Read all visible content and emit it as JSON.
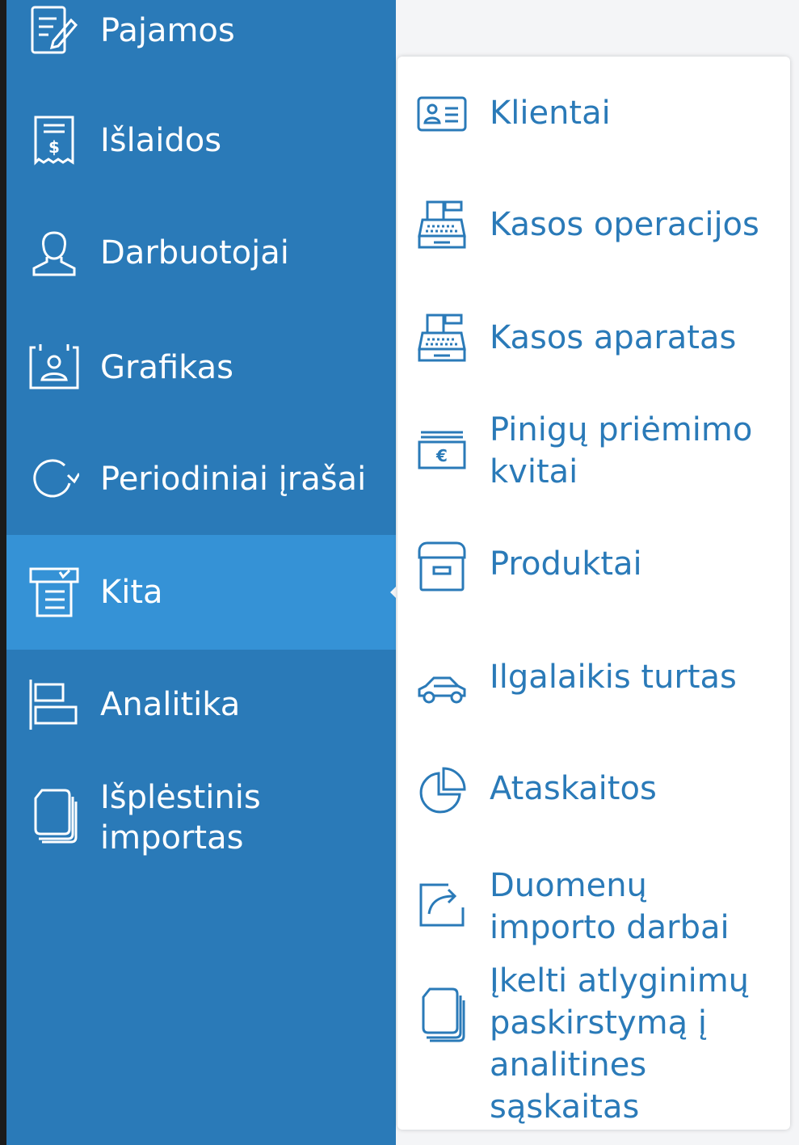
{
  "sidebar": {
    "items": [
      {
        "label": "Pajamos",
        "icon": "edit-document-icon"
      },
      {
        "label": "Išlaidos",
        "icon": "receipt-dollar-icon"
      },
      {
        "label": "Darbuotojai",
        "icon": "person-icon"
      },
      {
        "label": "Grafikas",
        "icon": "calendar-person-icon"
      },
      {
        "label": "Periodiniai įrašai",
        "icon": "refresh-icon"
      },
      {
        "label": "Kita",
        "icon": "list-box-icon"
      },
      {
        "label": "Analitika",
        "icon": "bar-chart-icon"
      },
      {
        "label": "Išplėstinis",
        "label2": "importas",
        "icon": "copy-icon"
      }
    ],
    "active_item": "Kita"
  },
  "dropdown": {
    "items": [
      {
        "label": "Klientai",
        "icon": "id-card-icon"
      },
      {
        "label": "Kasos operacijos",
        "icon": "cash-register-icon"
      },
      {
        "label": "Kasos aparatas",
        "icon": "cash-register-icon"
      },
      {
        "label": "Pinigų priėmimo",
        "label2": "kvitai",
        "icon": "euro-money-icon"
      },
      {
        "label": "Produktai",
        "icon": "archive-box-icon"
      },
      {
        "label": "Ilgalaikis turtas",
        "icon": "car-icon"
      },
      {
        "label": "Ataskaitos",
        "icon": "pie-chart-icon"
      },
      {
        "label": "Duomenų",
        "label2": "importo darbai",
        "icon": "share-arrow-icon"
      },
      {
        "label": "Įkelti atlyginimų",
        "label2": "paskirstymą į",
        "label3": "analitines",
        "label4": "sąskaitas",
        "icon": "copy-icon"
      }
    ]
  },
  "colors": {
    "sidebar": "#2a7ab8",
    "active": "#3592d6",
    "accent": "#2a7ab8"
  }
}
